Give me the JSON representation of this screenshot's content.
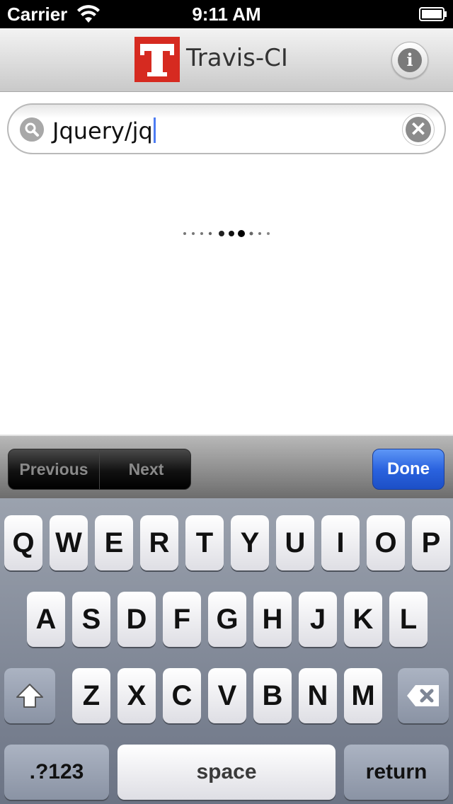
{
  "status_bar": {
    "carrier": "Carrier",
    "time": "9:11 AM",
    "wifi_icon": "wifi-icon",
    "battery_icon": "battery-icon"
  },
  "nav": {
    "logo_letter": "T",
    "title": "Travis-CI",
    "info_icon": "info-icon",
    "info_glyph": "i",
    "logo_color": "#d62a20"
  },
  "search": {
    "value": "Jquery/jq",
    "search_icon": "magnifier-icon",
    "clear_icon": "clear-icon",
    "clear_glyph": "✕"
  },
  "loading": {
    "icon": "loading-dots-icon"
  },
  "accessory": {
    "previous_label": "Previous",
    "next_label": "Next",
    "done_label": "Done",
    "accent": "#2b63df"
  },
  "keyboard": {
    "row1": [
      "Q",
      "W",
      "E",
      "R",
      "T",
      "Y",
      "U",
      "I",
      "O",
      "P"
    ],
    "row2": [
      "A",
      "S",
      "D",
      "F",
      "G",
      "H",
      "J",
      "K",
      "L"
    ],
    "row3": [
      "Z",
      "X",
      "C",
      "V",
      "B",
      "N",
      "M"
    ],
    "shift_icon": "shift-icon",
    "delete_icon": "backspace-icon",
    "numbers_label": ".?123",
    "space_label": "space",
    "return_label": "return"
  }
}
